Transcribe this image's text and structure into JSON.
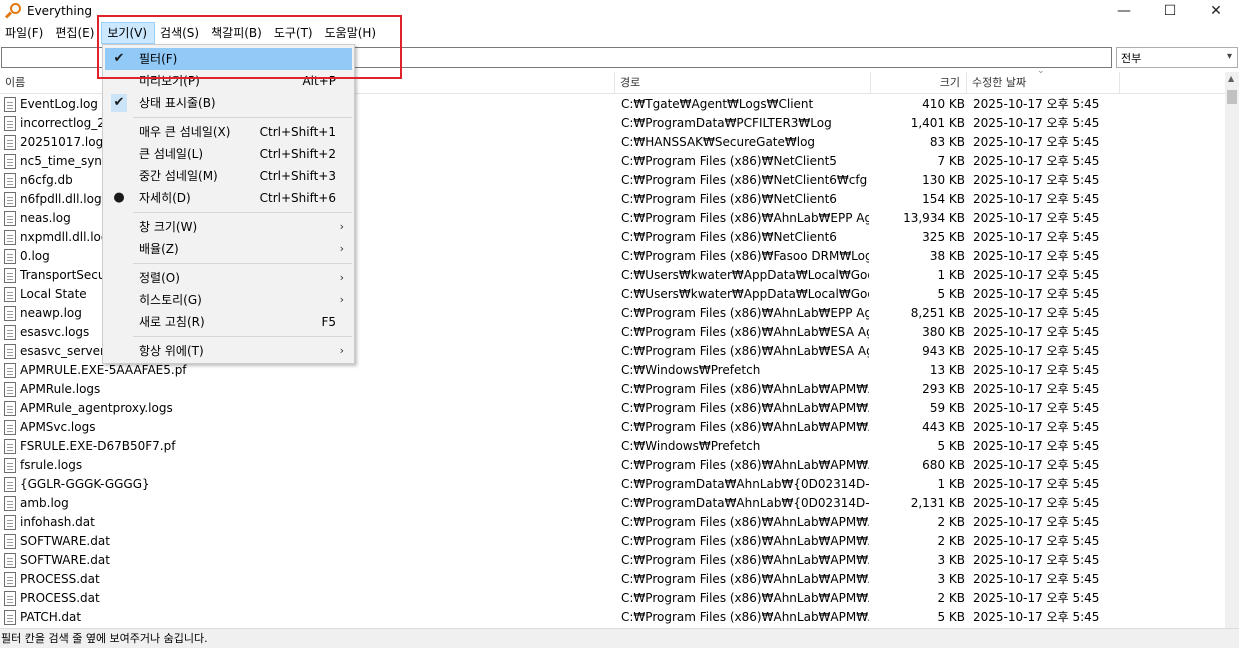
{
  "window": {
    "title": "Everything",
    "minimize": "—",
    "maximize": "☐",
    "close": "✕"
  },
  "menubar": {
    "items": [
      "파일(F)",
      "편집(E)",
      "보기(V)",
      "검색(S)",
      "책갈피(B)",
      "도구(T)",
      "도움말(H)"
    ],
    "active": "보기(V)"
  },
  "search": {
    "value": "",
    "filter_selected": "전부"
  },
  "columns": {
    "name": "이름",
    "path": "경로",
    "size": "크기",
    "date": "수정한 날짜"
  },
  "rows": [
    {
      "name": "EventLog.log",
      "path": "C:₩Tgate₩Agent₩Logs₩Client",
      "size": "410 KB",
      "date": "2025-10-17 오후 5:45"
    },
    {
      "name": "incorrectlog_20",
      "path": "C:₩ProgramData₩PCFILTER3₩Log",
      "size": "1,401 KB",
      "date": "2025-10-17 오후 5:45"
    },
    {
      "name": "20251017.log",
      "path": "C:₩HANSSAK₩SecureGate₩log",
      "size": "83 KB",
      "date": "2025-10-17 오후 5:45"
    },
    {
      "name": "nc5_time_sync.",
      "path": "C:₩Program Files (x86)₩NetClient5",
      "size": "7 KB",
      "date": "2025-10-17 오후 5:45"
    },
    {
      "name": "n6cfg.db",
      "path": "C:₩Program Files (x86)₩NetClient6₩cfg",
      "size": "130 KB",
      "date": "2025-10-17 오후 5:45"
    },
    {
      "name": "n6fpdll.dll.log",
      "path": "C:₩Program Files (x86)₩NetClient6",
      "size": "154 KB",
      "date": "2025-10-17 오후 5:45"
    },
    {
      "name": "neas.log",
      "path": "C:₩Program Files (x86)₩AhnLab₩EPP Agen...",
      "size": "13,934 KB",
      "date": "2025-10-17 오후 5:45"
    },
    {
      "name": "nxpmdll.dll.log",
      "path": "C:₩Program Files (x86)₩NetClient6",
      "size": "325 KB",
      "date": "2025-10-17 오후 5:45"
    },
    {
      "name": "0.log",
      "path": "C:₩Program Files (x86)₩Fasoo DRM₩Log",
      "size": "38 KB",
      "date": "2025-10-17 오후 5:45"
    },
    {
      "name": "TransportSecuri",
      "path": "C:₩Users₩kwater₩AppData₩Local₩Google...",
      "size": "1 KB",
      "date": "2025-10-17 오후 5:45"
    },
    {
      "name": "Local State",
      "path": "C:₩Users₩kwater₩AppData₩Local₩Google...",
      "size": "5 KB",
      "date": "2025-10-17 오후 5:45"
    },
    {
      "name": "neawp.log",
      "path": "C:₩Program Files (x86)₩AhnLab₩EPP Agen...",
      "size": "8,251 KB",
      "date": "2025-10-17 오후 5:45"
    },
    {
      "name": "esasvc.logs",
      "path": "C:₩Program Files (x86)₩AhnLab₩ESA Agen...",
      "size": "380 KB",
      "date": "2025-10-17 오후 5:45"
    },
    {
      "name": "esasvc_serverpr",
      "path": "C:₩Program Files (x86)₩AhnLab₩ESA Agen...",
      "size": "943 KB",
      "date": "2025-10-17 오후 5:45"
    },
    {
      "name": "APMRULE.EXE-5AAAFAE5.pf",
      "path": "C:₩Windows₩Prefetch",
      "size": "13 KB",
      "date": "2025-10-17 오후 5:45"
    },
    {
      "name": "APMRule.logs",
      "path": "C:₩Program Files (x86)₩AhnLab₩APM₩Ag...",
      "size": "293 KB",
      "date": "2025-10-17 오후 5:45"
    },
    {
      "name": "APMRule_agentproxy.logs",
      "path": "C:₩Program Files (x86)₩AhnLab₩APM₩Ag...",
      "size": "59 KB",
      "date": "2025-10-17 오후 5:45"
    },
    {
      "name": "APMSvc.logs",
      "path": "C:₩Program Files (x86)₩AhnLab₩APM₩Ag...",
      "size": "443 KB",
      "date": "2025-10-17 오후 5:45"
    },
    {
      "name": "FSRULE.EXE-D67B50F7.pf",
      "path": "C:₩Windows₩Prefetch",
      "size": "5 KB",
      "date": "2025-10-17 오후 5:45"
    },
    {
      "name": "fsrule.logs",
      "path": "C:₩Program Files (x86)₩AhnLab₩APM₩Ag...",
      "size": "680 KB",
      "date": "2025-10-17 오후 5:45"
    },
    {
      "name": "{GGLR-GGGK-GGGG}",
      "path": "C:₩ProgramData₩AhnLab₩{0D02314D-EC...",
      "size": "1 KB",
      "date": "2025-10-17 오후 5:45"
    },
    {
      "name": "amb.log",
      "path": "C:₩ProgramData₩AhnLab₩{0D02314D-EC...",
      "size": "2,131 KB",
      "date": "2025-10-17 오후 5:45"
    },
    {
      "name": "infohash.dat",
      "path": "C:₩Program Files (x86)₩AhnLab₩APM₩Ag...",
      "size": "2 KB",
      "date": "2025-10-17 오후 5:45"
    },
    {
      "name": "SOFTWARE.dat",
      "path": "C:₩Program Files (x86)₩AhnLab₩APM₩Ag...",
      "size": "2 KB",
      "date": "2025-10-17 오후 5:45"
    },
    {
      "name": "SOFTWARE.dat",
      "path": "C:₩Program Files (x86)₩AhnLab₩APM₩Ag...",
      "size": "3 KB",
      "date": "2025-10-17 오후 5:45"
    },
    {
      "name": "PROCESS.dat",
      "path": "C:₩Program Files (x86)₩AhnLab₩APM₩Ag...",
      "size": "3 KB",
      "date": "2025-10-17 오후 5:45"
    },
    {
      "name": "PROCESS.dat",
      "path": "C:₩Program Files (x86)₩AhnLab₩APM₩Ag...",
      "size": "2 KB",
      "date": "2025-10-17 오후 5:45"
    },
    {
      "name": "PATCH.dat",
      "path": "C:₩Program Files (x86)₩AhnLab₩APM₩Ag...",
      "size": "5 KB",
      "date": "2025-10-17 오후 5:45"
    }
  ],
  "view_menu": {
    "items": [
      {
        "label": "필터(F)",
        "shortcut": "",
        "mark": "check",
        "submenu": false,
        "hover": true
      },
      {
        "label": "미리보기(P)",
        "shortcut": "Alt+P",
        "mark": "",
        "submenu": false,
        "hover": false
      },
      {
        "label": "상태 표시줄(B)",
        "shortcut": "",
        "mark": "check",
        "submenu": false,
        "hover": false
      },
      {
        "label": "매우 큰 섬네일(X)",
        "shortcut": "Ctrl+Shift+1",
        "mark": "",
        "submenu": false,
        "hover": false
      },
      {
        "label": "큰 섬네일(L)",
        "shortcut": "Ctrl+Shift+2",
        "mark": "",
        "submenu": false,
        "hover": false
      },
      {
        "label": "중간 섬네일(M)",
        "shortcut": "Ctrl+Shift+3",
        "mark": "",
        "submenu": false,
        "hover": false
      },
      {
        "label": "자세히(D)",
        "shortcut": "Ctrl+Shift+6",
        "mark": "dot",
        "submenu": false,
        "hover": false
      },
      {
        "label": "창 크기(W)",
        "shortcut": "",
        "mark": "",
        "submenu": true,
        "hover": false
      },
      {
        "label": "배율(Z)",
        "shortcut": "",
        "mark": "",
        "submenu": true,
        "hover": false
      },
      {
        "label": "정렬(O)",
        "shortcut": "",
        "mark": "",
        "submenu": true,
        "hover": false
      },
      {
        "label": "히스토리(G)",
        "shortcut": "",
        "mark": "",
        "submenu": true,
        "hover": false
      },
      {
        "label": "새로 고침(R)",
        "shortcut": "F5",
        "mark": "",
        "submenu": false,
        "hover": false
      },
      {
        "label": "항상 위에(T)",
        "shortcut": "",
        "mark": "",
        "submenu": true,
        "hover": false
      }
    ]
  },
  "statusbar": {
    "text": "필터 칸을 검색 줄 옆에 보여주거나 숨깁니다."
  },
  "colors": {
    "accent_hover": "#91c9f7",
    "highlight_box": "#e0232a",
    "menu_active": "#cce8ff"
  }
}
